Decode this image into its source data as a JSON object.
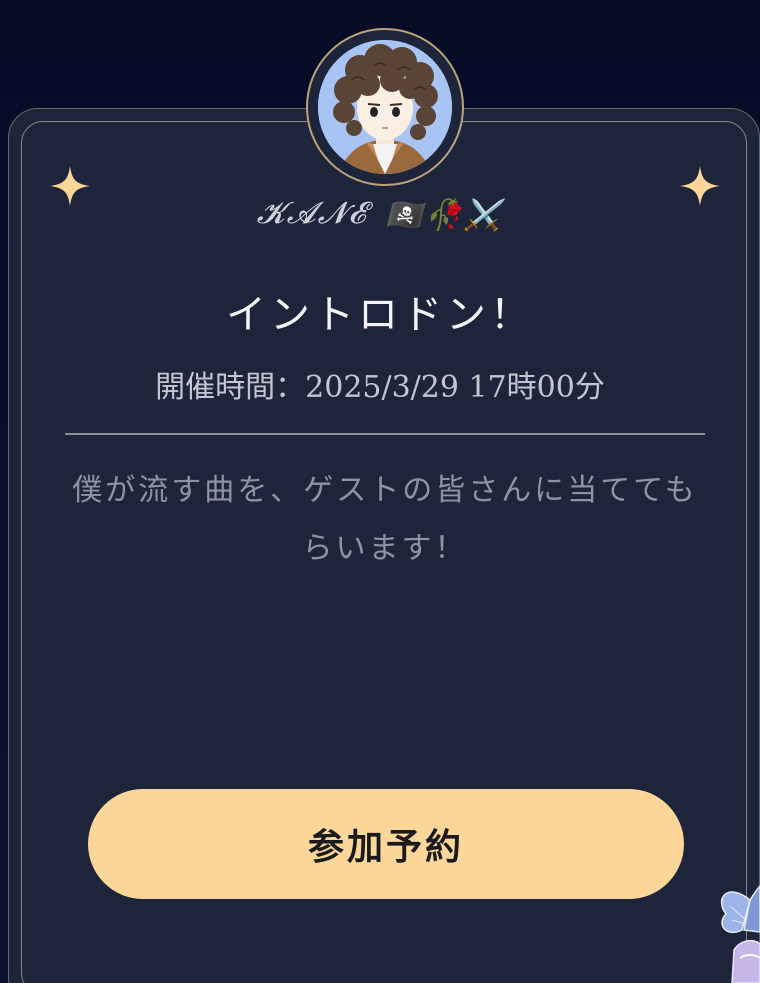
{
  "host": {
    "name": "𝓚𝓐𝓝𝓔",
    "emoji": "🏴‍☠️🥀⚔️"
  },
  "event": {
    "title": "イントロドン！",
    "schedule": "開催時間：2025/3/29 17時00分",
    "description": "僕が流す曲を、ゲストの皆さんに当ててもらいます！"
  },
  "actions": {
    "reserve_label": "参加予約"
  },
  "colors": {
    "background": "#070d24",
    "card": "#1e243a",
    "accent": "#fdd69a",
    "sparkle": "#fdd69a",
    "avatar_bg": "#a8c4f5"
  },
  "icons": {
    "sparkle_left": "sparkle-icon",
    "sparkle_right": "sparkle-icon",
    "butterfly": "butterfly-icon"
  }
}
